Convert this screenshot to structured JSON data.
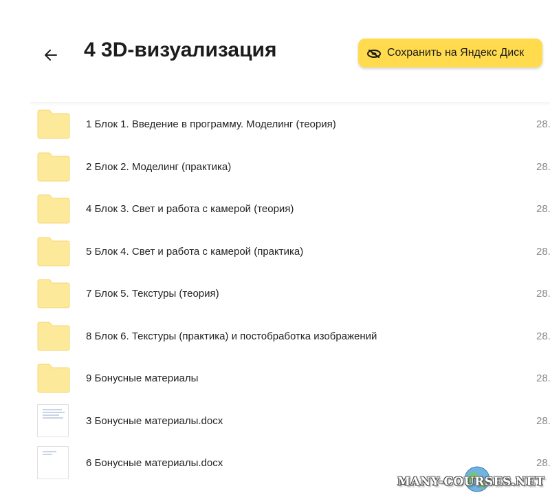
{
  "header": {
    "title": "4 3D-визуализация",
    "save_label": "Сохранить на Яндекс Диск",
    "back_icon": "arrow-left-icon",
    "accent_color": "#ffdb4d"
  },
  "files": [
    {
      "name": "1 Блок 1. Введение в программу. Моделинг (теория)",
      "date": "28.",
      "type": "folder"
    },
    {
      "name": "2 Блок 2. Моделинг (практика)",
      "date": "28.",
      "type": "folder"
    },
    {
      "name": "4 Блок 3. Свет и работа с камерой (теория)",
      "date": "28.",
      "type": "folder"
    },
    {
      "name": "5 Блок 4. Свет и работа с камерой (практика)",
      "date": "28.",
      "type": "folder"
    },
    {
      "name": "7 Блок 5. Текстуры (теория)",
      "date": "28.",
      "type": "folder"
    },
    {
      "name": "8 Блок 6. Текстуры (практика) и постобработка изображений",
      "date": "28.",
      "type": "folder"
    },
    {
      "name": "9 Бонусные материалы",
      "date": "28.",
      "type": "folder"
    },
    {
      "name": "3 Бонусные материалы.docx",
      "date": "28.",
      "type": "docx"
    },
    {
      "name": "6 Бонусные материалы.docx",
      "date": "28.",
      "type": "docx"
    }
  ],
  "watermark": {
    "text": "MANY-COURSES.NET"
  }
}
